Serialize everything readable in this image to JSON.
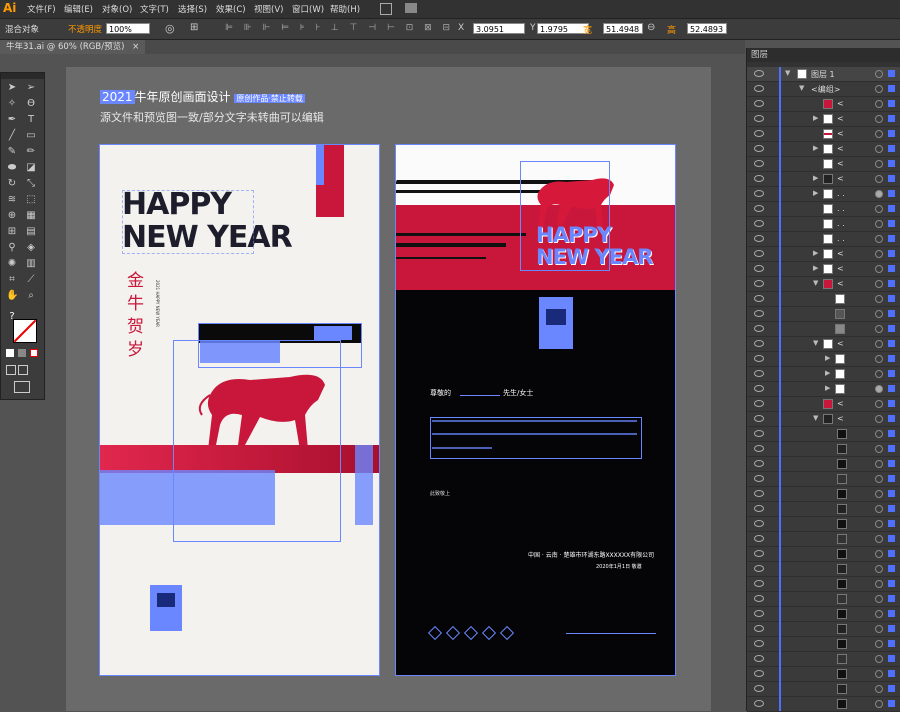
{
  "app": {
    "logo": "Ai"
  },
  "menu": [
    "文件(F)",
    "编辑(E)",
    "对象(O)",
    "文字(T)",
    "选择(S)",
    "效果(C)",
    "视图(V)",
    "窗口(W)",
    "帮助(H)"
  ],
  "control": {
    "mode_label": "混合对象",
    "opacity_label": "不透明度",
    "opacity_value": "100%",
    "x_value": "3.0951",
    "y_value": "1.9795",
    "w_label": "宽",
    "w_value": "51.4948",
    "h_label": "高",
    "h_value": "52.4893"
  },
  "document_tab": {
    "title": "牛年31.ai @ 60% (RGB/预览)",
    "close": "×"
  },
  "canvas": {
    "heading_prefix": "2021",
    "heading_main": "牛年原创画面设计",
    "heading_suffix": "原创作品·禁止转载",
    "subheading": "源文件和预览图一致/部分文字未转曲可以编辑"
  },
  "poster_left": {
    "line1": "HAPPY",
    "line2": "NEW YEAR",
    "vertical": "金牛贺岁",
    "vertical_small": "2021 HAPPY NEW YEAR"
  },
  "poster_right": {
    "line1": "HAPPY",
    "line2": "NEW YEAR",
    "greeting": "尊敬的",
    "greeting_suffix": "先生/女士",
    "sign_off": "此致敬上",
    "company": "中国 · 云南 · 楚雄市环湖东路XXXXXX有限公司",
    "date": "2020年1月1日 敬邀"
  },
  "layers_panel": {
    "title": "图层",
    "layer_name": "图层 1",
    "group_name": "<编组>",
    "sublayer_name": "<"
  },
  "colors": {
    "accent": "#6a87ff",
    "brand_red": "#d6183a",
    "ui_dark": "#323232"
  }
}
